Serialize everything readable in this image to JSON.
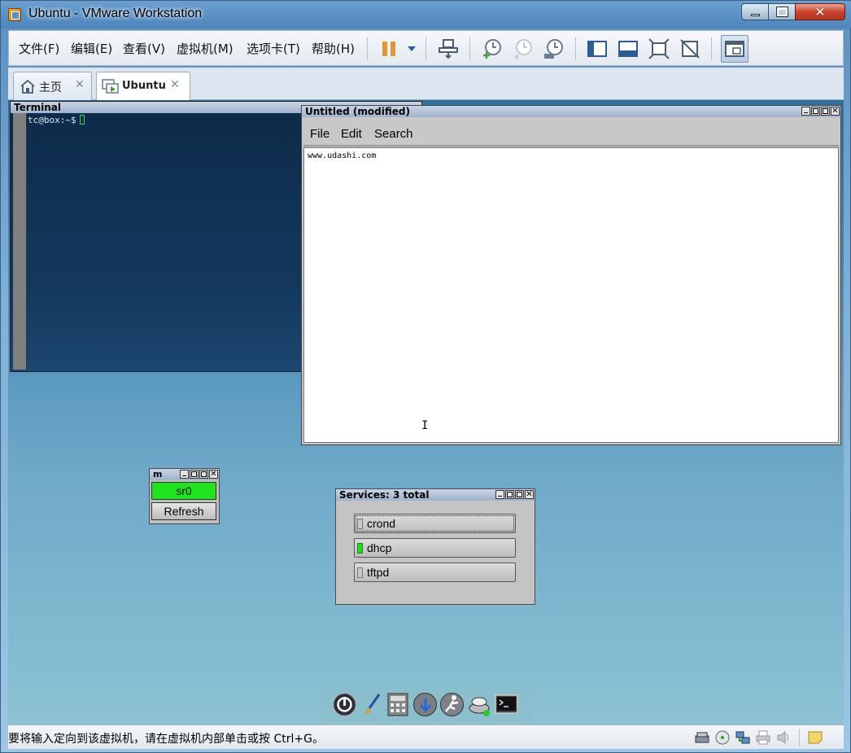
{
  "window": {
    "title": "Ubuntu - VMware Workstation"
  },
  "menu": {
    "items": [
      "文件(F)",
      "编辑(E)",
      "查看(V)",
      "虚拟机(M)",
      "选项卡(T)",
      "帮助(H)"
    ]
  },
  "tabs": [
    {
      "label": "主页",
      "icon": "home-icon"
    },
    {
      "label": "Ubuntu",
      "icon": "vm-icon"
    }
  ],
  "guest": {
    "terminal": {
      "title": "Terminal",
      "prompt": "tc@box:~$"
    },
    "editor": {
      "title": "Untitled (modified)",
      "menu": [
        "File",
        "Edit",
        "Search"
      ],
      "content": "www.udashi.com",
      "cursor_glyph": "I"
    },
    "mount": {
      "title": "m",
      "drive": "sr0",
      "refresh": "Refresh"
    },
    "services": {
      "title": "Services: 3 total",
      "items": [
        {
          "name": "crond",
          "running": false
        },
        {
          "name": "dhcp",
          "running": true
        },
        {
          "name": "tftpd",
          "running": false
        }
      ]
    },
    "dock": [
      "power-icon",
      "brush-icon",
      "calculator-icon",
      "install-icon",
      "run-icon",
      "apps-icon",
      "terminal-icon"
    ]
  },
  "status": {
    "text": "要将输入定向到该虚拟机，请在虚拟机内部单击或按 Ctrl+G。"
  },
  "colors": {
    "service_on": "#1fd81f",
    "mount_active": "#1fe51f"
  }
}
